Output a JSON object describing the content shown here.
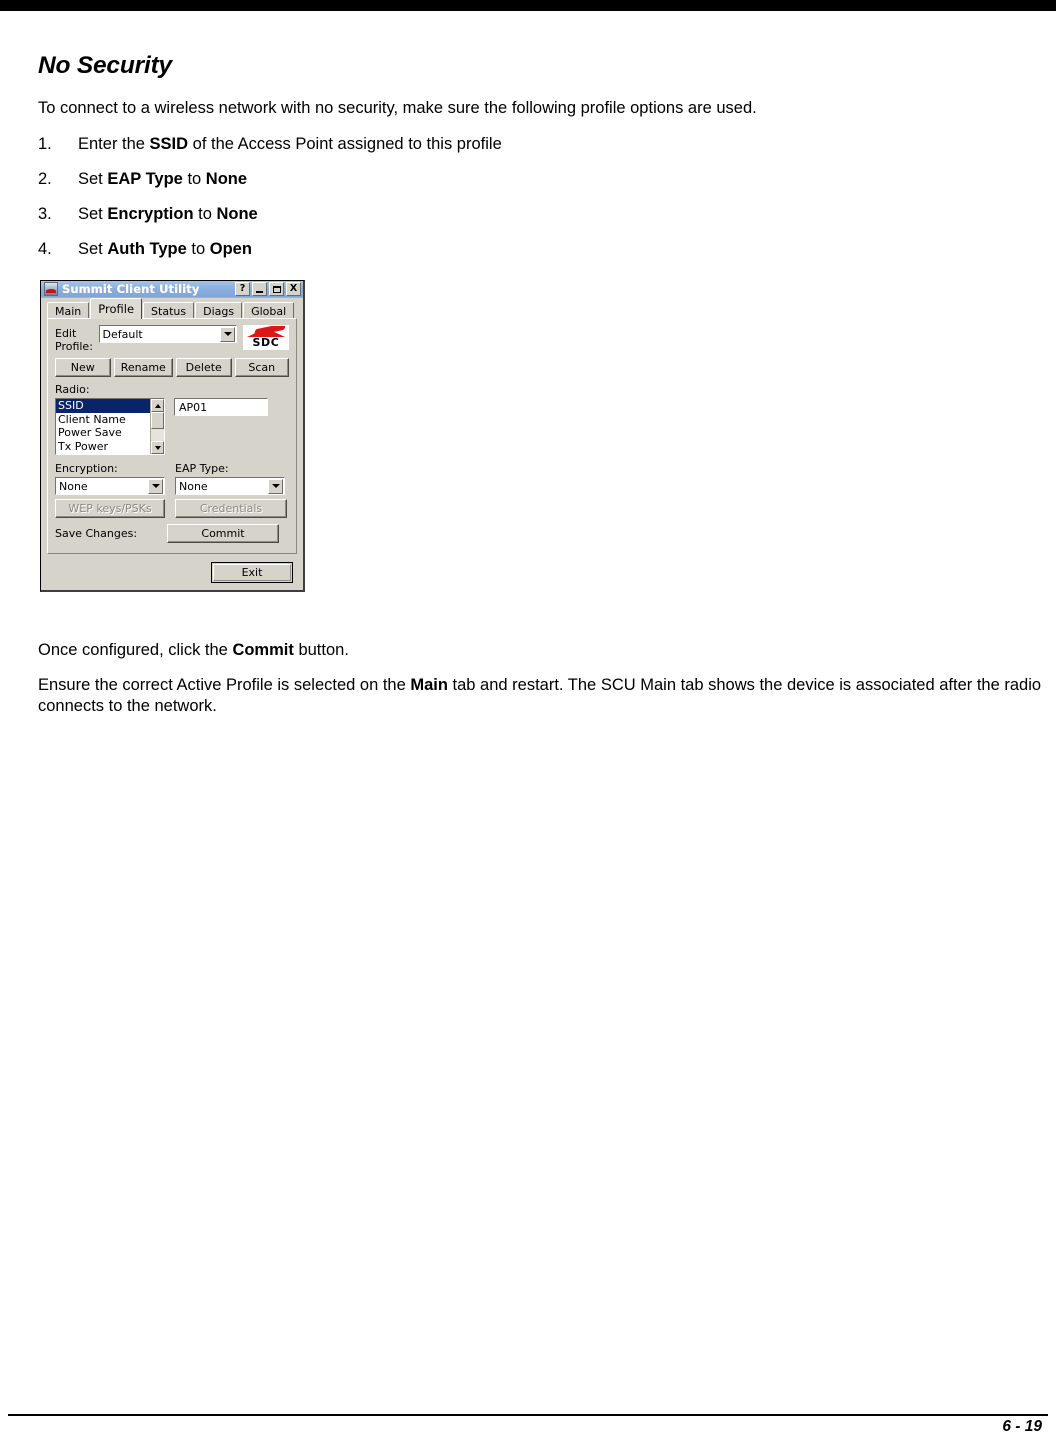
{
  "document": {
    "title": "No Security",
    "intro": "To connect to a wireless network with no security, make sure the following profile options are used.",
    "steps": [
      {
        "num": "1.",
        "pre": "Enter the ",
        "bold1": "SSID",
        "mid": " of the Access Point assigned to this profile",
        "bold2": "",
        "post": ""
      },
      {
        "num": "2.",
        "pre": "Set ",
        "bold1": "EAP Type",
        "mid": " to ",
        "bold2": "None",
        "post": ""
      },
      {
        "num": "3.",
        "pre": "Set ",
        "bold1": "Encryption",
        "mid": " to ",
        "bold2": "None",
        "post": ""
      },
      {
        "num": "4.",
        "pre": "Set ",
        "bold1": "Auth Type",
        "mid": " to ",
        "bold2": "Open",
        "post": ""
      }
    ],
    "after_para_1": {
      "pre": "Once configured, click the ",
      "bold": "Commit",
      "post": " button."
    },
    "after_para_2": {
      "pre": "Ensure the correct Active Profile is selected on the ",
      "bold": "Main",
      "post": " tab and restart. The SCU Main tab shows the device is associated after the radio connects to the network."
    },
    "footer_page": "6 - 19"
  },
  "dialog": {
    "title": "Summit Client Utility",
    "titlebar_buttons": {
      "help": "?",
      "minimize": "",
      "maximize": "",
      "close": "X"
    },
    "tabs": [
      {
        "label": "Main",
        "active": false
      },
      {
        "label": "Profile",
        "active": true
      },
      {
        "label": "Status",
        "active": false
      },
      {
        "label": "Diags",
        "active": false
      },
      {
        "label": "Global",
        "active": false
      }
    ],
    "edit_profile": {
      "label_line1": "Edit",
      "label_line2": "Profile:",
      "value": "Default"
    },
    "logo_text": "SDC",
    "buttons": {
      "new": "New",
      "rename": "Rename",
      "delete": "Delete",
      "scan": "Scan",
      "wep_keys": "WEP keys/PSKs",
      "credentials": "Credentials",
      "commit": "Commit",
      "exit": "Exit"
    },
    "radio": {
      "label": "Radio:",
      "items": [
        {
          "label": "SSID",
          "selected": true
        },
        {
          "label": "Client Name",
          "selected": false
        },
        {
          "label": "Power Save",
          "selected": false
        },
        {
          "label": "Tx Power",
          "selected": false
        }
      ],
      "value": "AP01"
    },
    "encryption": {
      "label": "Encryption:",
      "value": "None"
    },
    "eap_type": {
      "label": "EAP Type:",
      "value": "None"
    },
    "save_changes_label": "Save Changes:"
  },
  "colors": {
    "titlebar": "#8cb0dd",
    "dialog_face": "#d6d3cb",
    "selection": "#0a246a",
    "logo_red": "#dd1818",
    "topbar": "#000000"
  }
}
